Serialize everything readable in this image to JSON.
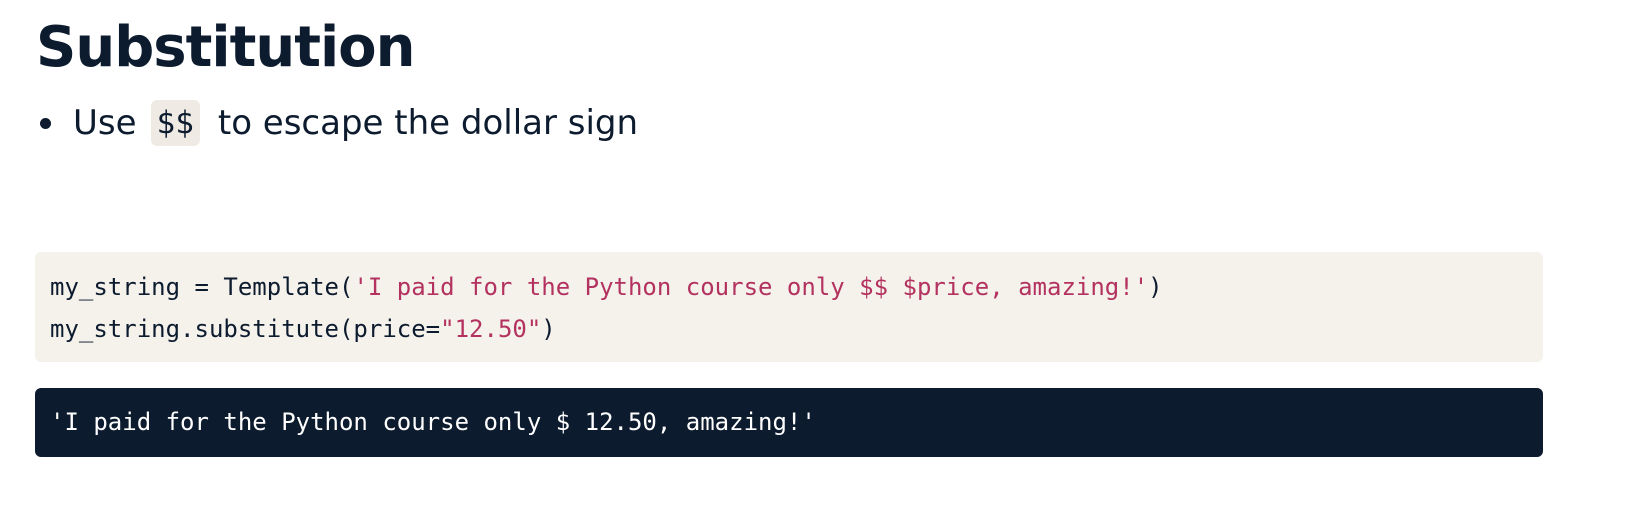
{
  "title": "Substitution",
  "bullets": [
    {
      "before": "Use",
      "code": "$$",
      "after": "to escape the dollar sign"
    }
  ],
  "code_block": {
    "line1": {
      "prefix": "my_string = Template(",
      "string": "'I paid for the Python course only $$ $price, amazing!'",
      "suffix": ")"
    },
    "line2": {
      "prefix": "my_string.substitute(price=",
      "string": "\"12.50\"",
      "suffix": ")"
    }
  },
  "output": "'I paid for the Python course only $ 12.50, amazing!'",
  "colors": {
    "text": "#0d1b2e",
    "code_background": "#f5f2ec",
    "string_literal": "#b3325f",
    "output_background": "#0d1b2e",
    "output_text": "#ffffff"
  }
}
